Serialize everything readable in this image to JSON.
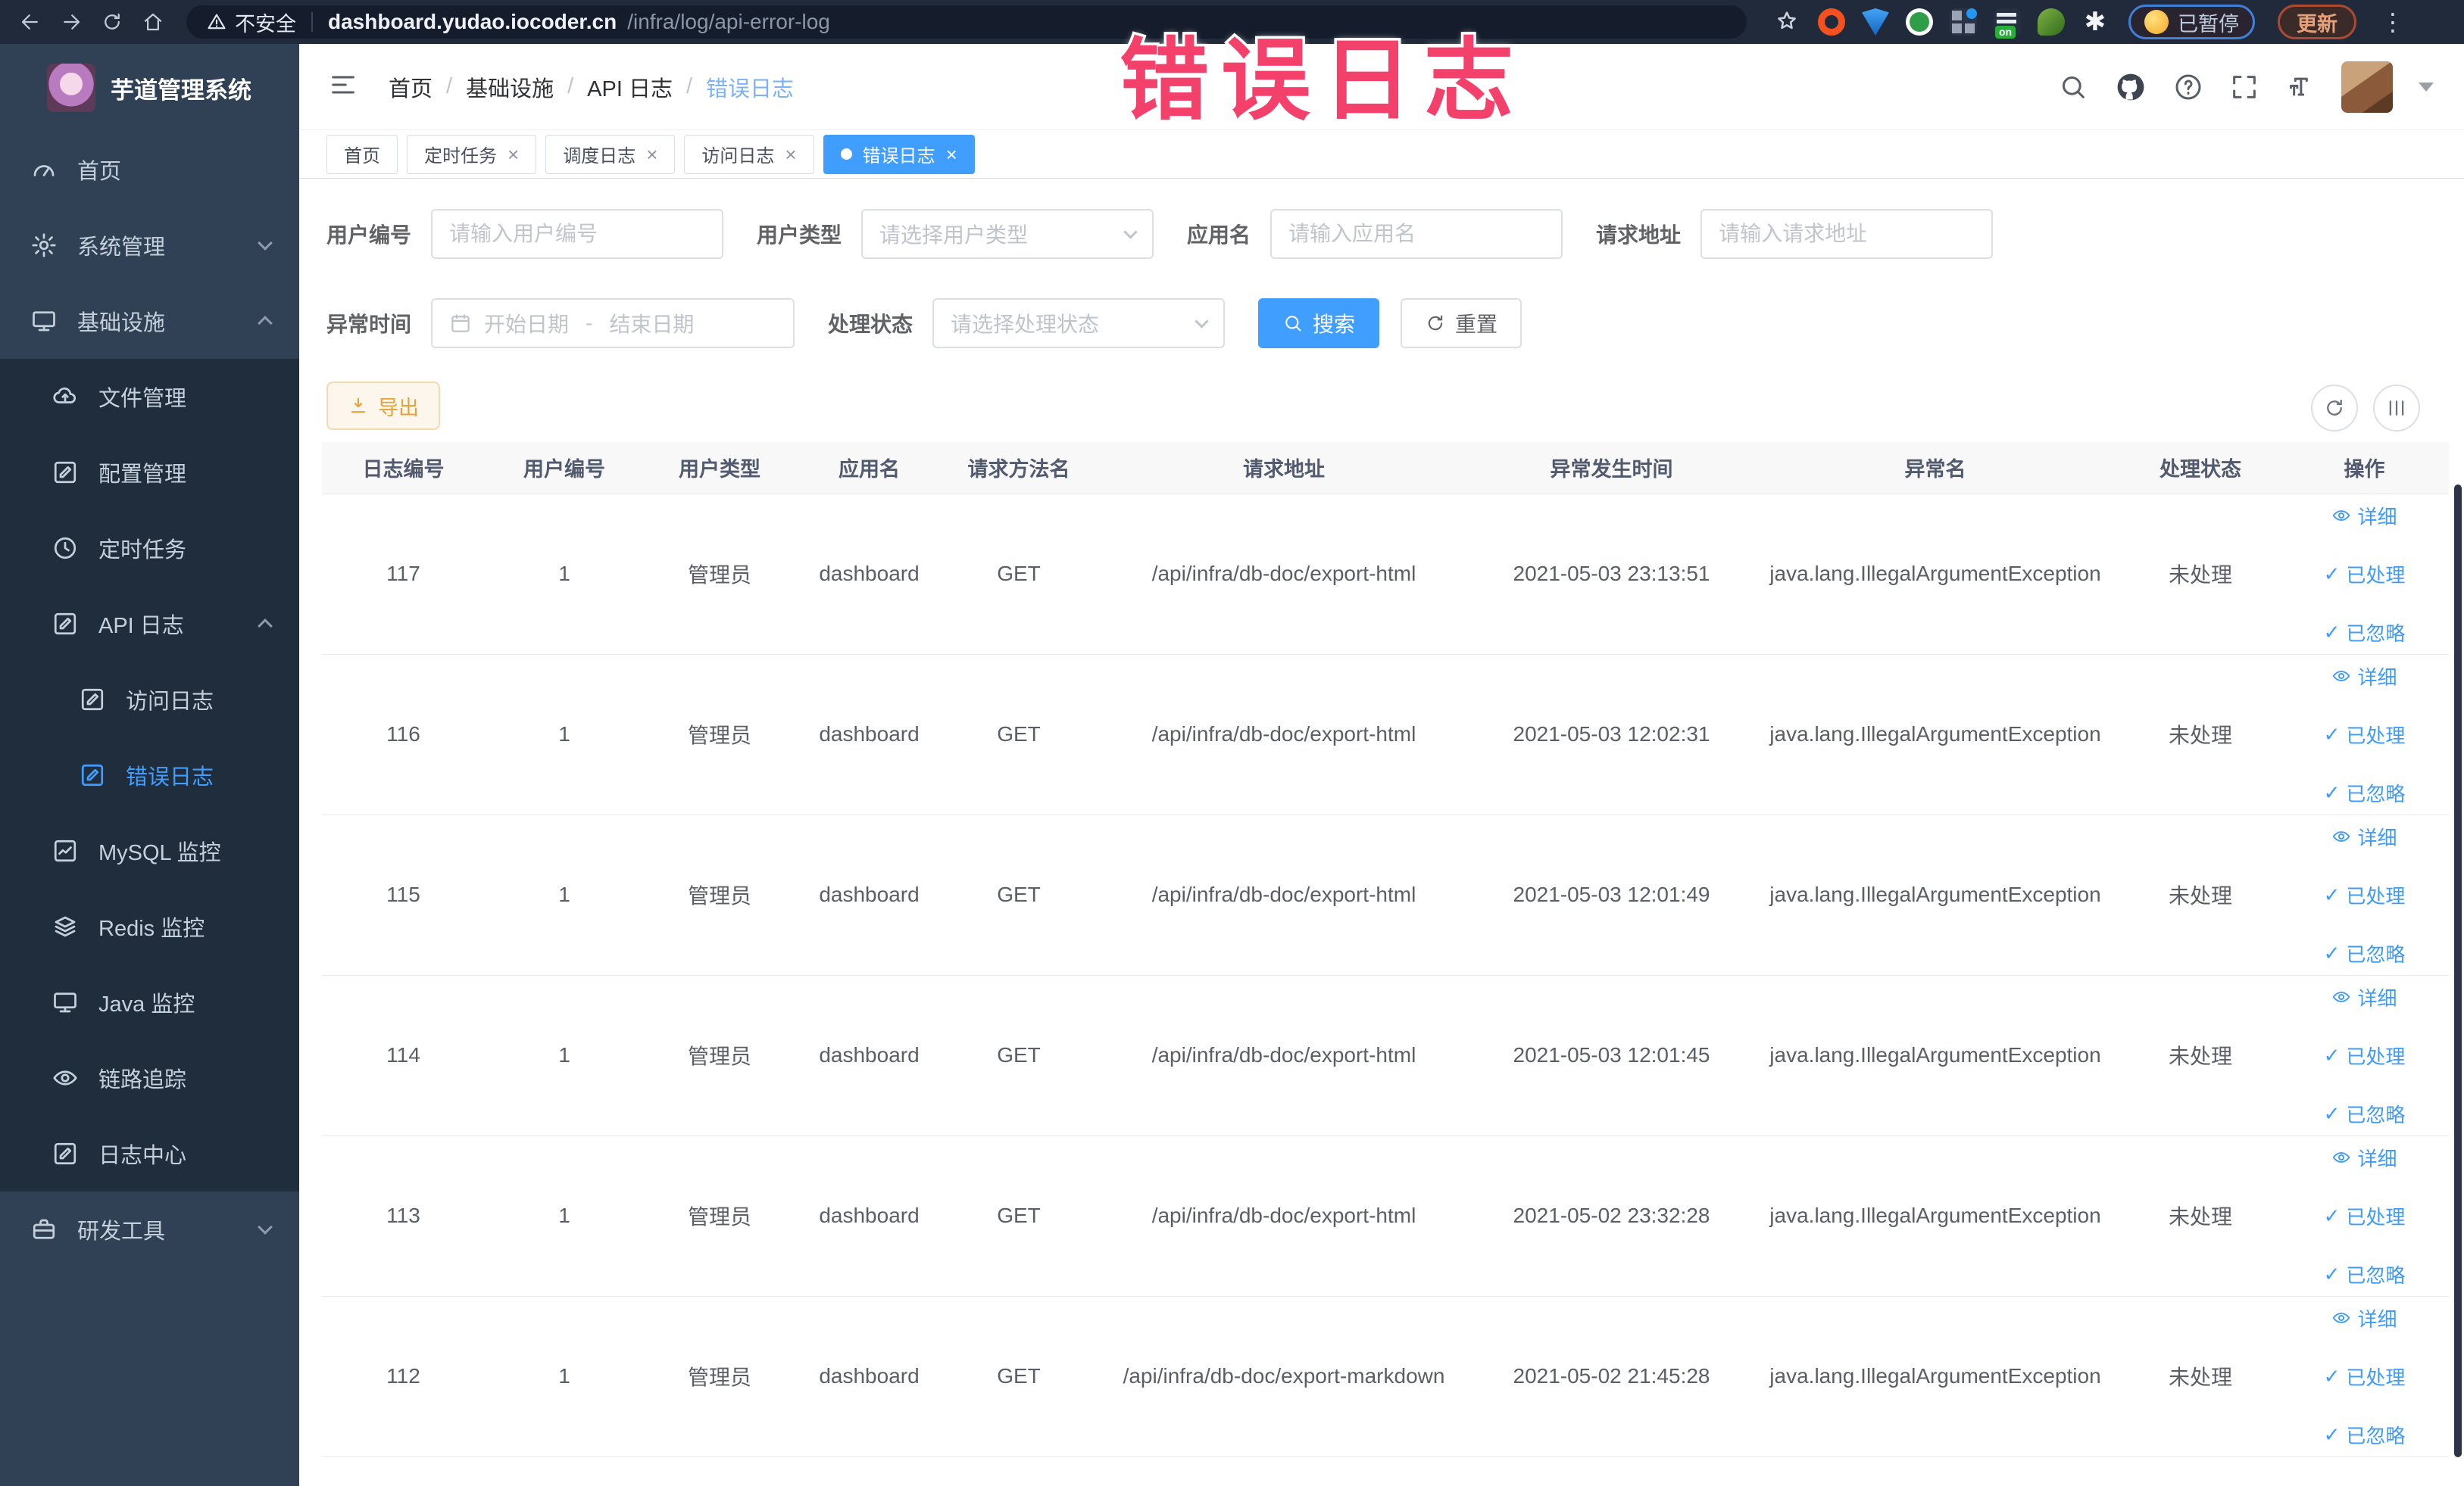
{
  "browser": {
    "security_label": "不安全",
    "url_host": "dashboard.yudao.iocoder.cn",
    "url_path": "/infra/log/api-error-log",
    "extension_on_badge": "on",
    "paused_badge_label": "已暂停",
    "update_button_label": "更新",
    "menu_dots": "⋮"
  },
  "overlay": {
    "title": "错误日志"
  },
  "sidebar": {
    "app_title": "芋道管理系统",
    "items": [
      {
        "label": "首页"
      },
      {
        "label": "系统管理"
      },
      {
        "label": "基础设施"
      },
      {
        "label": "文件管理"
      },
      {
        "label": "配置管理"
      },
      {
        "label": "定时任务"
      },
      {
        "label": "API 日志"
      },
      {
        "label": "访问日志"
      },
      {
        "label": "错误日志"
      },
      {
        "label": "MySQL 监控"
      },
      {
        "label": "Redis 监控"
      },
      {
        "label": "Java 监控"
      },
      {
        "label": "链路追踪"
      },
      {
        "label": "日志中心"
      },
      {
        "label": "研发工具"
      }
    ]
  },
  "header": {
    "breadcrumb": {
      "items": [
        "首页",
        "基础设施",
        "API 日志",
        "错误日志"
      ],
      "separator": "/"
    }
  },
  "tabs": [
    {
      "label": "首页"
    },
    {
      "label": "定时任务"
    },
    {
      "label": "调度日志"
    },
    {
      "label": "访问日志"
    },
    {
      "label": "错误日志"
    }
  ],
  "tab_close": "×",
  "filters": {
    "user_id_label": "用户编号",
    "user_id_placeholder": "请输入用户编号",
    "user_type_label": "用户类型",
    "user_type_placeholder": "请选择用户类型",
    "app_name_label": "应用名",
    "app_name_placeholder": "请输入应用名",
    "request_url_label": "请求地址",
    "request_url_placeholder": "请输入请求地址",
    "time_label": "异常时间",
    "time_start_placeholder": "开始日期",
    "time_separator": "-",
    "time_end_placeholder": "结束日期",
    "status_label": "处理状态",
    "status_placeholder": "请选择处理状态",
    "search_label": "搜索",
    "reset_label": "重置"
  },
  "toolbar": {
    "export_label": "导出"
  },
  "table": {
    "headers": [
      "日志编号",
      "用户编号",
      "用户类型",
      "应用名",
      "请求方法名",
      "请求地址",
      "异常发生时间",
      "异常名",
      "处理状态",
      "操作"
    ],
    "actions": {
      "detail": "详细",
      "processed": "已处理",
      "ignored": "已忽略",
      "check": "✓"
    },
    "rows": [
      {
        "log_id": "117",
        "user_id": "1",
        "user_type": "管理员",
        "app": "dashboard",
        "method": "GET",
        "url": "/api/infra/db-doc/export-html",
        "time": "2021-05-03 23:13:51",
        "exception": "java.lang.IllegalArgumentException",
        "status": "未处理"
      },
      {
        "log_id": "116",
        "user_id": "1",
        "user_type": "管理员",
        "app": "dashboard",
        "method": "GET",
        "url": "/api/infra/db-doc/export-html",
        "time": "2021-05-03 12:02:31",
        "exception": "java.lang.IllegalArgumentException",
        "status": "未处理"
      },
      {
        "log_id": "115",
        "user_id": "1",
        "user_type": "管理员",
        "app": "dashboard",
        "method": "GET",
        "url": "/api/infra/db-doc/export-html",
        "time": "2021-05-03 12:01:49",
        "exception": "java.lang.IllegalArgumentException",
        "status": "未处理"
      },
      {
        "log_id": "114",
        "user_id": "1",
        "user_type": "管理员",
        "app": "dashboard",
        "method": "GET",
        "url": "/api/infra/db-doc/export-html",
        "time": "2021-05-03 12:01:45",
        "exception": "java.lang.IllegalArgumentException",
        "status": "未处理"
      },
      {
        "log_id": "113",
        "user_id": "1",
        "user_type": "管理员",
        "app": "dashboard",
        "method": "GET",
        "url": "/api/infra/db-doc/export-html",
        "time": "2021-05-02 23:32:28",
        "exception": "java.lang.IllegalArgumentException",
        "status": "未处理"
      },
      {
        "log_id": "112",
        "user_id": "1",
        "user_type": "管理员",
        "app": "dashboard",
        "method": "GET",
        "url": "/api/infra/db-doc/export-markdown",
        "time": "2021-05-02 21:45:28",
        "exception": "java.lang.IllegalArgumentException",
        "status": "未处理"
      }
    ]
  },
  "colors": {
    "accent": "#409eff",
    "sidebar_bg": "#304156",
    "submenu_bg": "#1f2d3d",
    "export_text": "#e6a23c",
    "annotation": "#f4416b"
  }
}
